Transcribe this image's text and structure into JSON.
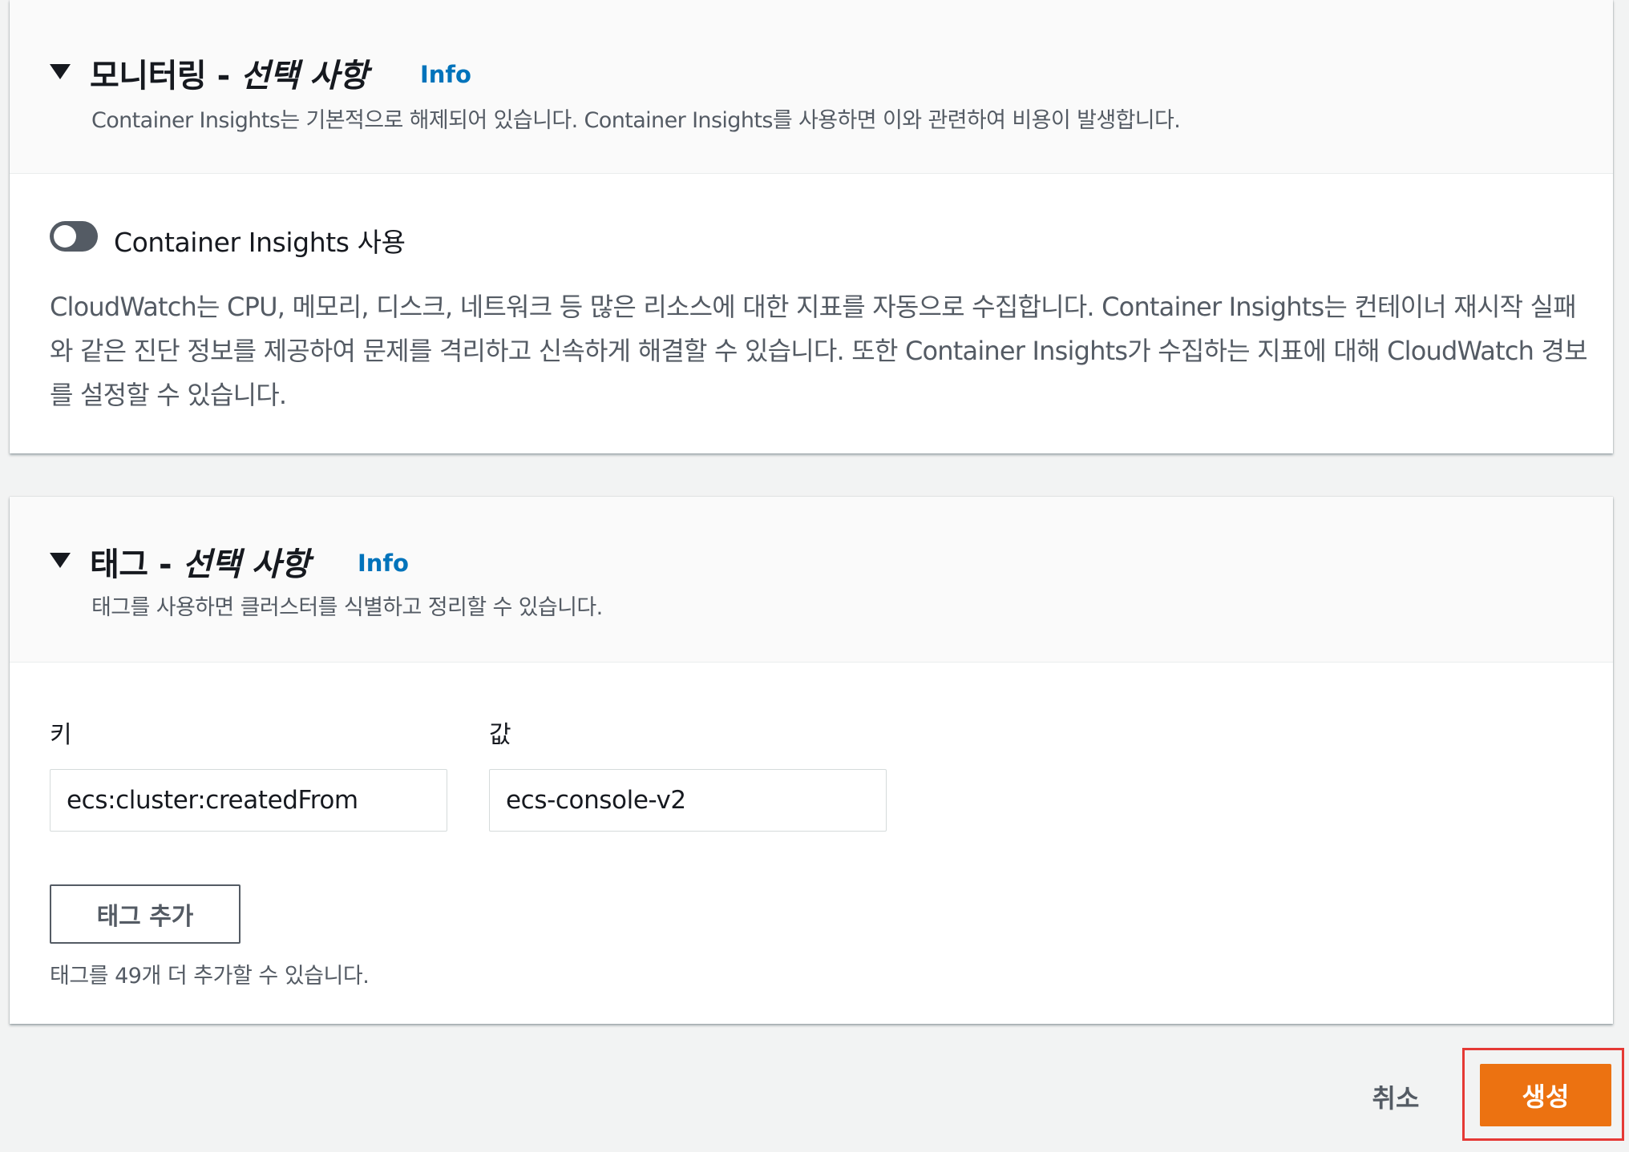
{
  "monitoring": {
    "title_main": "모니터링 - ",
    "title_optional": "선택 사항",
    "info_link": "Info",
    "description": "Container Insights는 기본적으로 해제되어 있습니다. Container Insights를 사용하면 이와 관련하여 비용이 발생합니다.",
    "toggle_label": "Container Insights 사용",
    "toggle_on": false,
    "body_text": "CloudWatch는 CPU, 메모리, 디스크, 네트워크 등 많은 리소스에 대한 지표를 자동으로 수집합니다. Container Insights는 컨테이너 재시작 실패와 같은 진단 정보를 제공하여 문제를 격리하고 신속하게 해결할 수 있습니다. 또한 Container Insights가 수집하는 지표에 대해 CloudWatch 경보를 설정할 수 있습니다."
  },
  "tags": {
    "title_main": "태그 - ",
    "title_optional": "선택 사항",
    "info_link": "Info",
    "description": "태그를 사용하면 클러스터를 식별하고 정리할 수 있습니다.",
    "key_label": "키",
    "value_label": "값",
    "key_value": "ecs:cluster:createdFrom",
    "value_value": "ecs-console-v2",
    "add_button": "태그 추가",
    "hint": "태그를 49개 더 추가할 수 있습니다."
  },
  "actions": {
    "cancel": "취소",
    "create": "생성"
  },
  "colors": {
    "primary_button": "#ec7211",
    "link": "#0073bb",
    "highlight": "#e53935",
    "toggle_off": "#545b64"
  },
  "icons": {
    "section_expand": "caret-down-icon"
  }
}
